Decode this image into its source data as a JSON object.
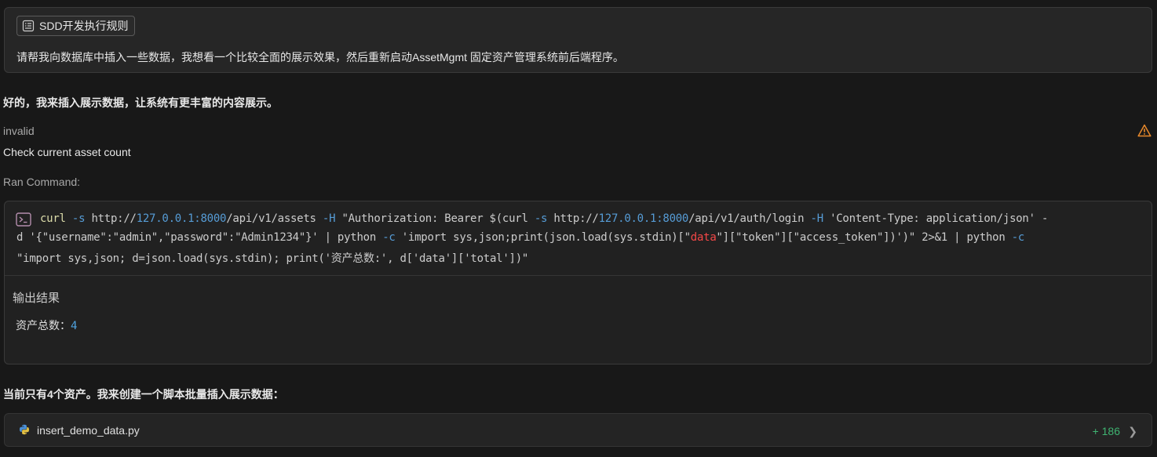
{
  "user_message": {
    "rule_chip": "SDD开发执行规则",
    "text": "请帮我向数据库中插入一些数据，我想看一个比较全面的展示效果，然后重新启动AssetMgmt 固定资产管理系统前后端程序。"
  },
  "assistant": {
    "intro": "好的，我来插入展示数据，让系统有更丰富的内容展示。",
    "status": "invalid",
    "step_title": "Check current asset count",
    "ran_label": "Ran Command:",
    "command_lines": [
      "curl -s http://127.0.0.1:8000/api/v1/assets -H \"Authorization: Bearer $(curl -s http://127.0.0.1:8000/api/v1/auth/login -H 'Content-Type: application/json' -",
      "d '{\"username\":\"admin\",\"password\":\"Admin1234\"}' | python -c 'import sys,json;print(json.load(sys.stdin)[\"data\"][\"token\"][\"access_token\"])')\" 2>&1 | python -c",
      "\"import sys,json; d=json.load(sys.stdin); print('资产总数:', d['data']['total'])\""
    ],
    "output_title": "输出结果",
    "output_label": "资产总数：",
    "output_value": "4",
    "note": "当前只有4个资产。我来创建一个脚本批量插入展示数据：",
    "file": {
      "name": "insert_demo_data.py",
      "added": "+ 186",
      "icon": "python-icon"
    }
  },
  "colors": {
    "background": "#181818",
    "warning": "#e8892b",
    "added": "#3fb371",
    "link_number": "#4fa3e0"
  }
}
